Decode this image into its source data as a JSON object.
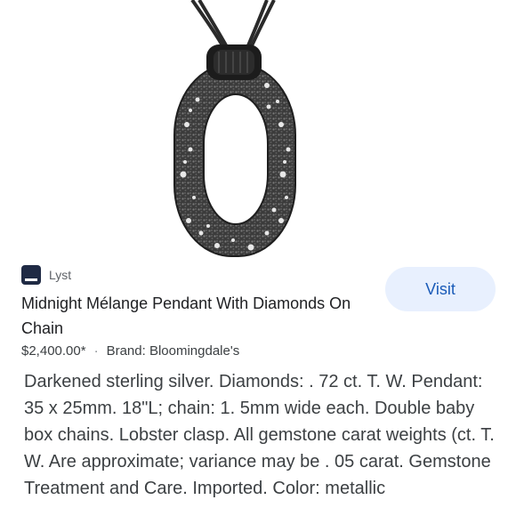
{
  "product": {
    "image_alt": "Midnight Mélange pendant",
    "source": "Lyst",
    "title": "Midnight Mélange Pendant With Diamonds On Chain",
    "visit_label": "Visit",
    "price": "$2,400.00*",
    "separator": "·",
    "brand": "Brand: Bloomingdale's",
    "description": "Darkened sterling silver. Diamonds: . 72 ct. T. W. Pendant: 35 x 25mm. 18\"L; chain: 1. 5mm wide each. Double baby box chains. Lobster clasp. All gemstone carat weights (ct. T. W. Are approximate; variance may be . 05 carat. Gemstone Treatment and Care. Imported. Color: metallic"
  },
  "colors": {
    "visit_bg": "#e8f0fe",
    "visit_text": "#1a5bb8",
    "source_logo": "#1f2a44"
  },
  "icons": {
    "source_logo": "lyst-logo-icon"
  }
}
